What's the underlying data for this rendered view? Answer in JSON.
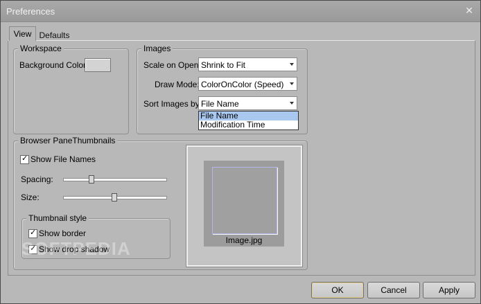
{
  "window": {
    "title": "Preferences",
    "close_glyph": "✕"
  },
  "tabs": [
    {
      "label": "View"
    },
    {
      "label": "Defaults"
    }
  ],
  "workspace": {
    "legend": "Workspace",
    "background_color_label": "Background Color:"
  },
  "images": {
    "legend": "Images",
    "scale_label": "Scale on Open:",
    "scale_value": "Shrink to Fit",
    "draw_label": "Draw Mode:",
    "draw_value": "ColorOnColor (Speed)",
    "sort_label": "Sort Images by:",
    "sort_value": "File Name",
    "sort_options": [
      "File Name",
      "Modification Time"
    ]
  },
  "browser": {
    "legend": "Browser PaneThumbnails",
    "show_file_names": "Show File Names",
    "spacing_label": "Spacing:",
    "size_label": "Size:",
    "spacing_level": 0.28,
    "size_level": 0.5
  },
  "thumbnail_style": {
    "legend": "Thumbnail style",
    "show_border": "Show border",
    "show_drop_shadow": "Show drop shadow"
  },
  "preview": {
    "filename": "Image.jpg"
  },
  "buttons": {
    "ok": "OK",
    "cancel": "Cancel",
    "apply": "Apply"
  },
  "watermark": "SOFTPEDIA",
  "colors": {
    "window_bg": "#b8b8b8",
    "selection": "#a8c8f0",
    "ok_focus": "#e7d08a"
  }
}
